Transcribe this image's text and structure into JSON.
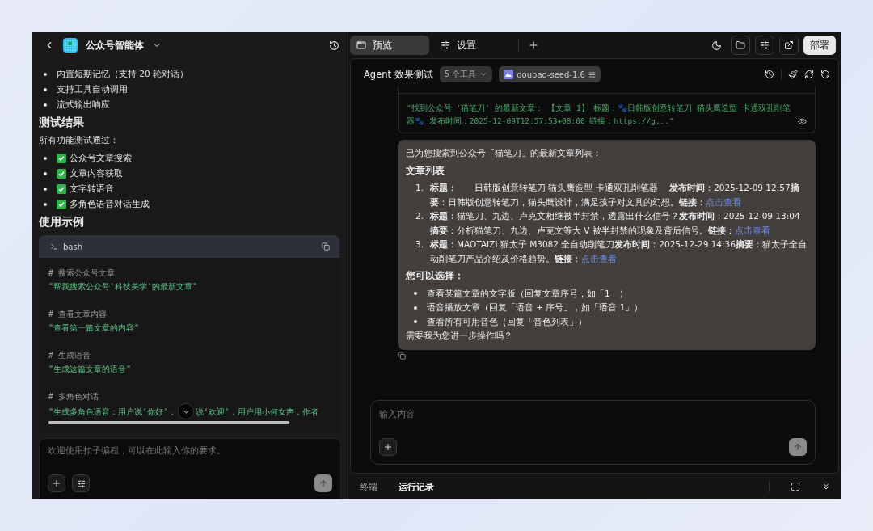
{
  "left_header": {
    "title": "公众号智能体"
  },
  "left_content": {
    "features": [
      "内置短期记忆（支持 20 轮对话）",
      "支持工具自动调用",
      "流式输出响应"
    ],
    "results_heading": "测试结果",
    "results_intro": "所有功能测试通过：",
    "results": [
      {
        "text": "公众号文章搜索",
        "checked": true
      },
      {
        "text": "文章内容获取",
        "checked": true
      },
      {
        "text": "文字转语音",
        "checked": true
      },
      {
        "text": "多角色语音对话生成",
        "checked": true
      }
    ],
    "examples_heading": "使用示例",
    "code": {
      "language": "bash",
      "blocks": [
        {
          "comment": "#  搜索公众号文章",
          "command": "\"帮我搜索公众号'科技美学'的最新文章\""
        },
        {
          "comment": "#  查看文章内容",
          "command": "\"查看第一篇文章的内容\""
        },
        {
          "comment": "#  生成语音",
          "command": "\"生成这篇文章的语音\""
        },
        {
          "comment": "#  多角色对话",
          "command": "\"生成多角色语音：用户说'你好'，",
          "command_rest": "说'欢迎'，用户用小何女声，作者"
        }
      ]
    }
  },
  "left_composer": {
    "placeholder": "欢迎使用扣子编程，可以在此输入你的要求。"
  },
  "top_tabs": [
    {
      "label": "预览",
      "selected": true
    },
    {
      "label": "设置",
      "selected": false
    }
  ],
  "deploy_button": "部署",
  "chat_header": {
    "title": "Agent 效果测试",
    "tools": "5 个工具",
    "model": "doubao-seed-1.6"
  },
  "tool_output": {
    "result": "\"找到公众号 '猫笔刀' 的最新文章： 【文章 1】 标题：🐾日韩版创意转笔刀 猫头鹰造型 卡通双孔削笔器🐾 发布时间：2025-12-09T12:57:53+08:00 链接：https://g...\""
  },
  "message": {
    "intro": "已为您搜索到公众号「猫笔刀」的最新文章列表：",
    "list_heading": "文章列表",
    "articles": [
      {
        "number": "1.",
        "text": "**标题**：　　日韩版创意转笔刀 猫头鹰造型 卡通双孔削笔器　 **发布时间**：2025-12-09 12:57**摘要**：日韩版创意转笔刀，猫头鹰设计，满足孩子对文具的幻想。**链接**：",
        "link": "点击查看"
      },
      {
        "number": "2.",
        "text": "**标题**：猫笔刀、九边、卢克文相继被半封禁，透露出什么信号？**发布时间**：2025-12-09 13:04**摘要**：分析猫笔刀、九边、卢克文等大 V 被半封禁的现象及背后信号。**链接**：",
        "link": "点击查看"
      },
      {
        "number": "3.",
        "text": "**标题**：MAOTAIZI 猫太子 M3082 全自动削笔刀**发布时间**：2025-12-29 14:36**摘要**：猫太子全自动削笔刀产品介绍及价格趋势。**链接**：",
        "link": "点击查看"
      }
    ],
    "options_heading": "您可以选择：",
    "options": [
      "查看某篇文章的文字版（回复文章序号，如「1」）",
      "语音播放文章（回复「语音 + 序号」，如「语音 1」）",
      "查看所有可用音色（回复「音色列表」）"
    ],
    "closing": "需要我为您进一步操作吗？"
  },
  "chat_composer": {
    "placeholder": "输入内容"
  },
  "bottom_tabs": [
    {
      "label": "终端",
      "selected": false
    },
    {
      "label": "运行记录",
      "selected": true
    }
  ]
}
